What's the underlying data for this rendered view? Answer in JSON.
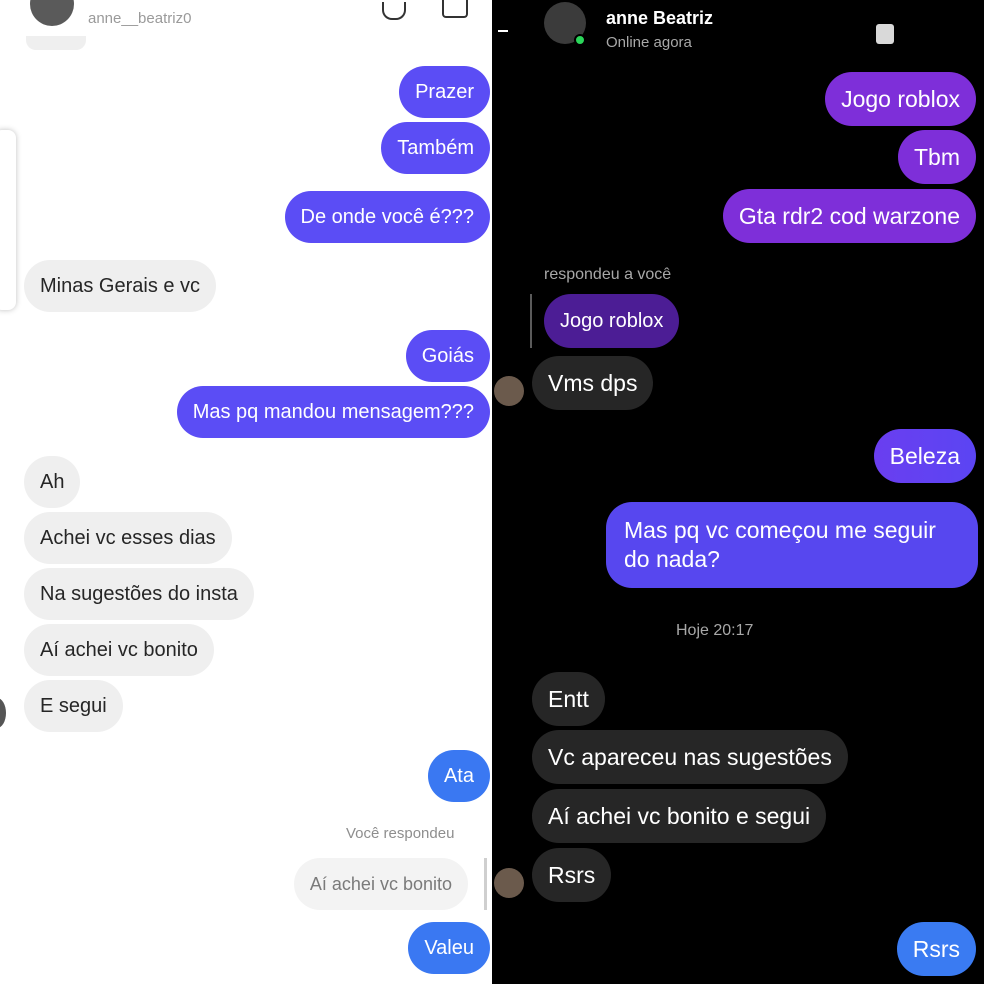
{
  "left": {
    "header": {
      "username": "anne__beatriz0"
    },
    "messages_top": [
      {
        "id": "m1",
        "text": "Prazer",
        "side": "out"
      },
      {
        "id": "m2",
        "text": "Também",
        "side": "out"
      },
      {
        "id": "m3",
        "text": "De onde você é???",
        "side": "out"
      },
      {
        "id": "m4",
        "text": "Minas Gerais e vc",
        "side": "in"
      },
      {
        "id": "m5",
        "text": "Goiás",
        "side": "out"
      },
      {
        "id": "m6",
        "text": "Mas pq mandou mensagem???",
        "side": "out"
      },
      {
        "id": "m7",
        "text": "Ah",
        "side": "in"
      },
      {
        "id": "m8",
        "text": "Achei vc esses dias",
        "side": "in"
      },
      {
        "id": "m9",
        "text": "Na sugestões do insta",
        "side": "in"
      },
      {
        "id": "m10",
        "text": "Aí achei vc bonito",
        "side": "in"
      },
      {
        "id": "m11",
        "text": "E segui",
        "side": "in"
      },
      {
        "id": "m12",
        "text": "Ata",
        "side": "out"
      }
    ],
    "reply_label": "Você respondeu",
    "reply_quote": "Aí achei vc bonito",
    "last_message": "Valeu"
  },
  "right": {
    "header": {
      "name": "anne Beatriz",
      "status": "Online agora"
    },
    "messages": [
      {
        "text": "Jogo roblox"
      },
      {
        "text": "Tbm"
      },
      {
        "text": "Gta rdr2 cod warzone"
      }
    ],
    "reply_label": "respondeu a você",
    "reply_quote": "Jogo roblox",
    "reply_message": "Vms dps",
    "beleza": "Beleza",
    "long_message": "Mas pq vc começou me seguir do nada?",
    "timestamp": "Hoje 20:17",
    "incoming": [
      {
        "text": "Entt"
      },
      {
        "text": "Vc apareceu nas sugestões"
      },
      {
        "text": "Aí achei vc bonito e segui"
      },
      {
        "text": "Rsrs"
      }
    ],
    "last_message": "Rsrs"
  },
  "colors": {
    "light_outgoing": "#5b4df5",
    "light_outgoing_blue": "#3a78f2",
    "light_incoming": "#efefef",
    "dark_purple": "#7e2fd9",
    "dark_incoming": "#262626",
    "dark_blue": "#3a7bf2",
    "online_dot": "#2bd65a"
  }
}
